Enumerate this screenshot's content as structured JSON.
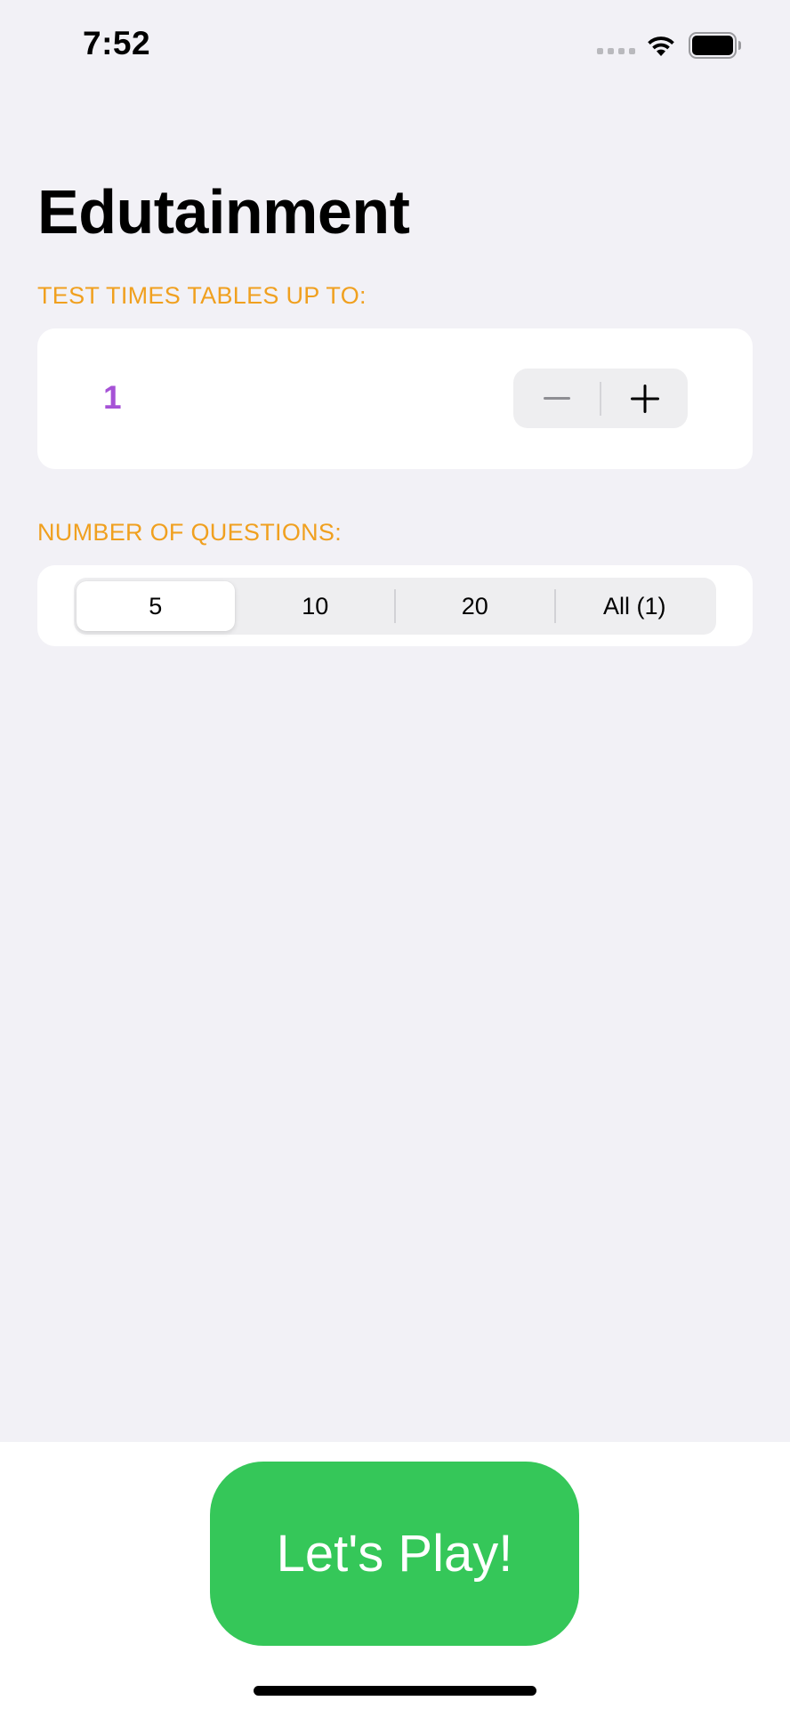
{
  "status_bar": {
    "time": "7:52",
    "icons": [
      "cellular-signal-icon",
      "wifi-icon",
      "battery-icon"
    ]
  },
  "title": "Edutainment",
  "tables_section": {
    "header": "TEST TIMES TABLES UP TO:",
    "value": "1",
    "decrement_icon": "minus-icon",
    "increment_icon": "plus-icon"
  },
  "questions_section": {
    "header": "NUMBER OF QUESTIONS:",
    "options": [
      "5",
      "10",
      "20",
      "All (1)"
    ],
    "selected": "5"
  },
  "play_button": {
    "label": "Let's Play!"
  },
  "colors": {
    "background": "#f2f1f6",
    "section_header": "#f0a01f",
    "stepper_value": "#a652d6",
    "play_button": "#35c759",
    "card": "#ffffff"
  }
}
